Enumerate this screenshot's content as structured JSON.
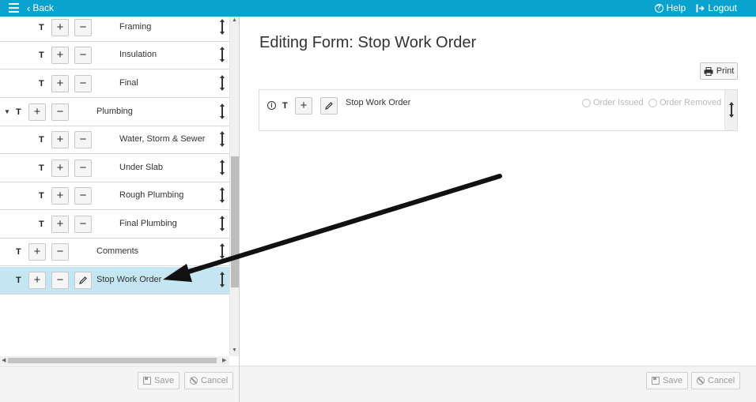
{
  "topbar": {
    "back_label": "Back",
    "help_label": "Help",
    "logout_label": "Logout",
    "color": "#0aa3cf"
  },
  "tree": {
    "rows": [
      {
        "label": "Framing",
        "type_label": "T",
        "level": 2
      },
      {
        "label": "Insulation",
        "type_label": "T",
        "level": 2
      },
      {
        "label": "Final",
        "type_label": "T",
        "level": 2
      },
      {
        "label": "Plumbing",
        "type_label": "T",
        "level": 1,
        "expanded": true
      },
      {
        "label": "Water, Storm & Sewer",
        "type_label": "T",
        "level": 2
      },
      {
        "label": "Under Slab",
        "type_label": "T",
        "level": 2
      },
      {
        "label": "Rough Plumbing",
        "type_label": "T",
        "level": 2
      },
      {
        "label": "Final Plumbing",
        "type_label": "T",
        "level": 2
      },
      {
        "label": "Comments",
        "type_label": "T",
        "level": 1
      },
      {
        "label": "Stop Work Order",
        "type_label": "T",
        "level": 1,
        "selected": true
      }
    ],
    "add_symbol": "+",
    "remove_symbol": "−"
  },
  "left_footer": {
    "save_label": "Save",
    "cancel_label": "Cancel"
  },
  "editor": {
    "title": "Editing Form: Stop Work Order",
    "print_label": "Print",
    "field": {
      "type_label": "T",
      "name": "Stop Work Order",
      "options": [
        "Order Issued",
        "Order Removed"
      ]
    }
  },
  "right_footer": {
    "save_label": "Save",
    "cancel_label": "Cancel"
  },
  "colors": {
    "selected_row": "#c4e6f2",
    "annotation_arrow": "#111111"
  }
}
